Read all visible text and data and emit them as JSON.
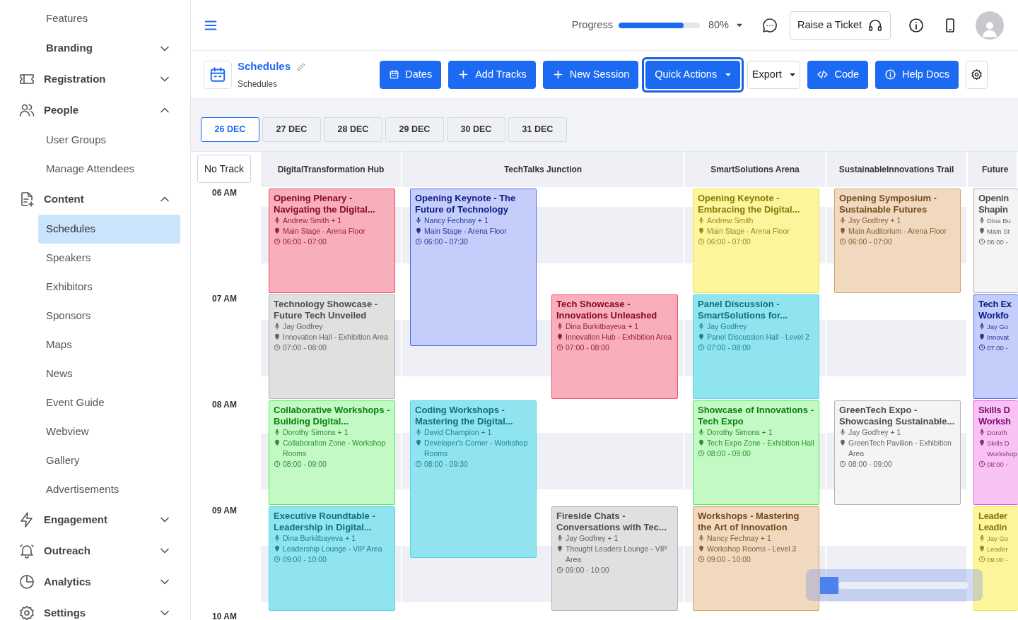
{
  "sidebar": {
    "items": [
      {
        "label": "Features",
        "kind": "link",
        "selected": false
      },
      {
        "label": "Branding",
        "kind": "subgroup",
        "expanded": false
      },
      {
        "label": "Registration",
        "kind": "section",
        "expanded": false
      },
      {
        "label": "People",
        "kind": "section",
        "expanded": true,
        "children": [
          {
            "label": "User Groups",
            "selected": false
          },
          {
            "label": "Manage Attendees",
            "selected": false
          }
        ]
      },
      {
        "label": "Content",
        "kind": "section",
        "expanded": true,
        "children": [
          {
            "label": "Schedules",
            "selected": true
          },
          {
            "label": "Speakers",
            "selected": false
          },
          {
            "label": "Exhibitors",
            "selected": false
          },
          {
            "label": "Sponsors",
            "selected": false
          },
          {
            "label": "Maps",
            "selected": false
          },
          {
            "label": "News",
            "selected": false
          },
          {
            "label": "Event Guide",
            "selected": false
          },
          {
            "label": "Webview",
            "selected": false
          },
          {
            "label": "Gallery",
            "selected": false
          },
          {
            "label": "Advertisements",
            "selected": false
          }
        ]
      },
      {
        "label": "Engagement",
        "kind": "section",
        "expanded": false
      },
      {
        "label": "Outreach",
        "kind": "section",
        "expanded": false
      },
      {
        "label": "Analytics",
        "kind": "section",
        "expanded": false
      },
      {
        "label": "Settings",
        "kind": "section",
        "expanded": false
      }
    ]
  },
  "header": {
    "progress_label": "Progress",
    "progress": {
      "level": 0.8
    },
    "progress_text": "80%",
    "ticket_button": "Raise a Ticket"
  },
  "toolbar": {
    "title": "Schedules",
    "subtitle": "Schedules",
    "buttons": [
      {
        "label": "Dates",
        "dropdown": false,
        "focused": false
      },
      {
        "label": "Add Tracks",
        "dropdown": false,
        "focused": false
      },
      {
        "label": "New Session",
        "dropdown": false,
        "focused": false
      },
      {
        "label": "Quick Actions",
        "dropdown": true,
        "focused": true
      },
      {
        "label": "Export",
        "dropdown": true,
        "focused": false
      },
      {
        "label": "Code",
        "dropdown": false,
        "focused": false
      },
      {
        "label": "Help Docs",
        "dropdown": false,
        "focused": false
      },
      {
        "dropdown": false,
        "focused": false
      }
    ]
  },
  "date_tabs": [
    {
      "label": "26 DEC",
      "selected": true
    },
    {
      "label": "27 DEC",
      "selected": false
    },
    {
      "label": "28 DEC",
      "selected": false
    },
    {
      "label": "29 DEC",
      "selected": false
    },
    {
      "label": "30 DEC",
      "selected": false
    },
    {
      "label": "31 DEC",
      "selected": false
    }
  ],
  "schedule": {
    "no_track_button": "No Track",
    "time_labels": [
      "06 AM",
      "07 AM",
      "08 AM",
      "09 AM",
      "10 AM"
    ],
    "tracks": [
      {
        "name": "DigitalTransformation Hub",
        "lanes": [
          {
            "sessions": [
              {
                "title": "Opening Plenary - Navigating the Digital...",
                "speaker": "Andrew Smith + 1",
                "location": "Main Stage - Arena Floor",
                "time": "06:00 - 07:00",
                "color": "#f9aebb"
              },
              {
                "title": "Technology Showcase - Future Tech Unveiled",
                "speaker": "Jay Godfrey",
                "location": "Innovation Hall - Exhibition Area",
                "time": "07:00 - 08:00",
                "color": "#e0e0e0"
              },
              {
                "title": "Collaborative Workshops - Building Digital...",
                "speaker": "Dorothy Simons + 1",
                "location": "Collaboration Zone - Workshop Rooms",
                "time": "08:00 - 09:00",
                "color": "#c3f9c5"
              },
              {
                "title": "Executive Roundtable - Leadership in Digital...",
                "speaker": "Dina Burkitbayeva + 1",
                "location": "Leadership Lounge - VIP Area",
                "time": "09:00 - 10:00",
                "color": "#90e4f0"
              }
            ]
          }
        ]
      },
      {
        "name": "TechTalks Junction",
        "lanes": [
          {
            "sessions": [
              {
                "title": "Opening Keynote - The Future of Technology",
                "speaker": "Nancy Fechnay + 1",
                "location": "Main Stage - Arena Floor",
                "time": "06:00 - 07:30",
                "color": "#c5cdfa"
              },
              {
                "title": "Coding Workshops - Mastering the Digital...",
                "speaker": "David Champion + 1",
                "location": "Developer's Corner - Workshop Rooms",
                "time": "08:00 - 09:30",
                "color": "#90e4f0"
              }
            ]
          },
          {
            "sessions": [
              {
                "title": "Tech Showcase - Innovations Unleashed",
                "speaker": "Dina Burkitbayeva + 1",
                "location": "Innovation Hub - Exhibition Area",
                "time": "07:00 - 08:00",
                "color": "#f9aebb"
              },
              {
                "title": "Fireside Chats - Conversations with Tec...",
                "speaker": "Jay Godfrey + 1",
                "location": "Thought Leaders Lounge - VIP Area",
                "time": "09:00 - 10:00",
                "color": "#e0e0e0"
              }
            ]
          }
        ]
      },
      {
        "name": "SmartSolutions Arena",
        "lanes": [
          {
            "sessions": [
              {
                "title": "Opening Keynote - Embracing the Digital...",
                "speaker": "Andrew Smith",
                "location": "Main Stage - Arena Floor",
                "time": "06:00 - 07:00",
                "color": "#fdf59b"
              },
              {
                "title": "Panel Discussion - SmartSolutions for...",
                "speaker": "Jay Godfrey",
                "location": "Panel Discussion Hall - Level 2",
                "time": "07:00 - 08:00",
                "color": "#90e4f0"
              },
              {
                "title": "Showcase of Innovations - Tech Expo",
                "speaker": "Dorothy Simons + 1",
                "location": "Tech Expo Zone - Exhibition Hall",
                "time": "08:00 - 09:00",
                "color": "#c3f9c5"
              },
              {
                "title": "Workshops - Mastering the Art of Innovation",
                "speaker": "Nancy Fechnay + 1",
                "location": "Workshop Rooms - Level 3",
                "time": "09:00 - 10:00",
                "color": "#f0d9bf"
              }
            ]
          }
        ]
      },
      {
        "name": "SustainableInnovations Trail",
        "lanes": [
          {
            "sessions": [
              {
                "title": "Opening Symposium - Sustainable Futures",
                "speaker": "Jay Godfrey + 1",
                "location": "Main Auditorium - Arena Floor",
                "time": "06:00 - 07:00",
                "color": "#f0d9bf"
              },
              {
                "title": "GreenTech Expo - Showcasing Sustainable...",
                "speaker": "Jay Godfrey + 1",
                "location": "GreenTech Pavilion - Exhibition Area",
                "time": "08:00 - 09:00",
                "color": "#f4f4f4"
              }
            ]
          }
        ]
      },
      {
        "name": "Future",
        "lanes": [
          {
            "sessions": [
              {
                "title": "Openin Shapin",
                "speaker": "Dina Bu",
                "location": "Main St",
                "time": "06:00 -",
                "color": "#f4f4f4"
              },
              {
                "title": "Tech Ex Workfo",
                "speaker": "Jay Go",
                "location": "Innovat",
                "time": "07:00 -",
                "color": "#c5cdfa"
              },
              {
                "title": "Skills D Worksh",
                "speaker": "Doroth",
                "location": "Skills D Workshop",
                "time": "08:00 -",
                "color": "#f8c3f3"
              },
              {
                "title": "Leader Leadin",
                "speaker": "Jay Go",
                "location": "Leader",
                "time": "09:00 -",
                "color": "#fdf59b"
              }
            ]
          }
        ]
      }
    ]
  }
}
